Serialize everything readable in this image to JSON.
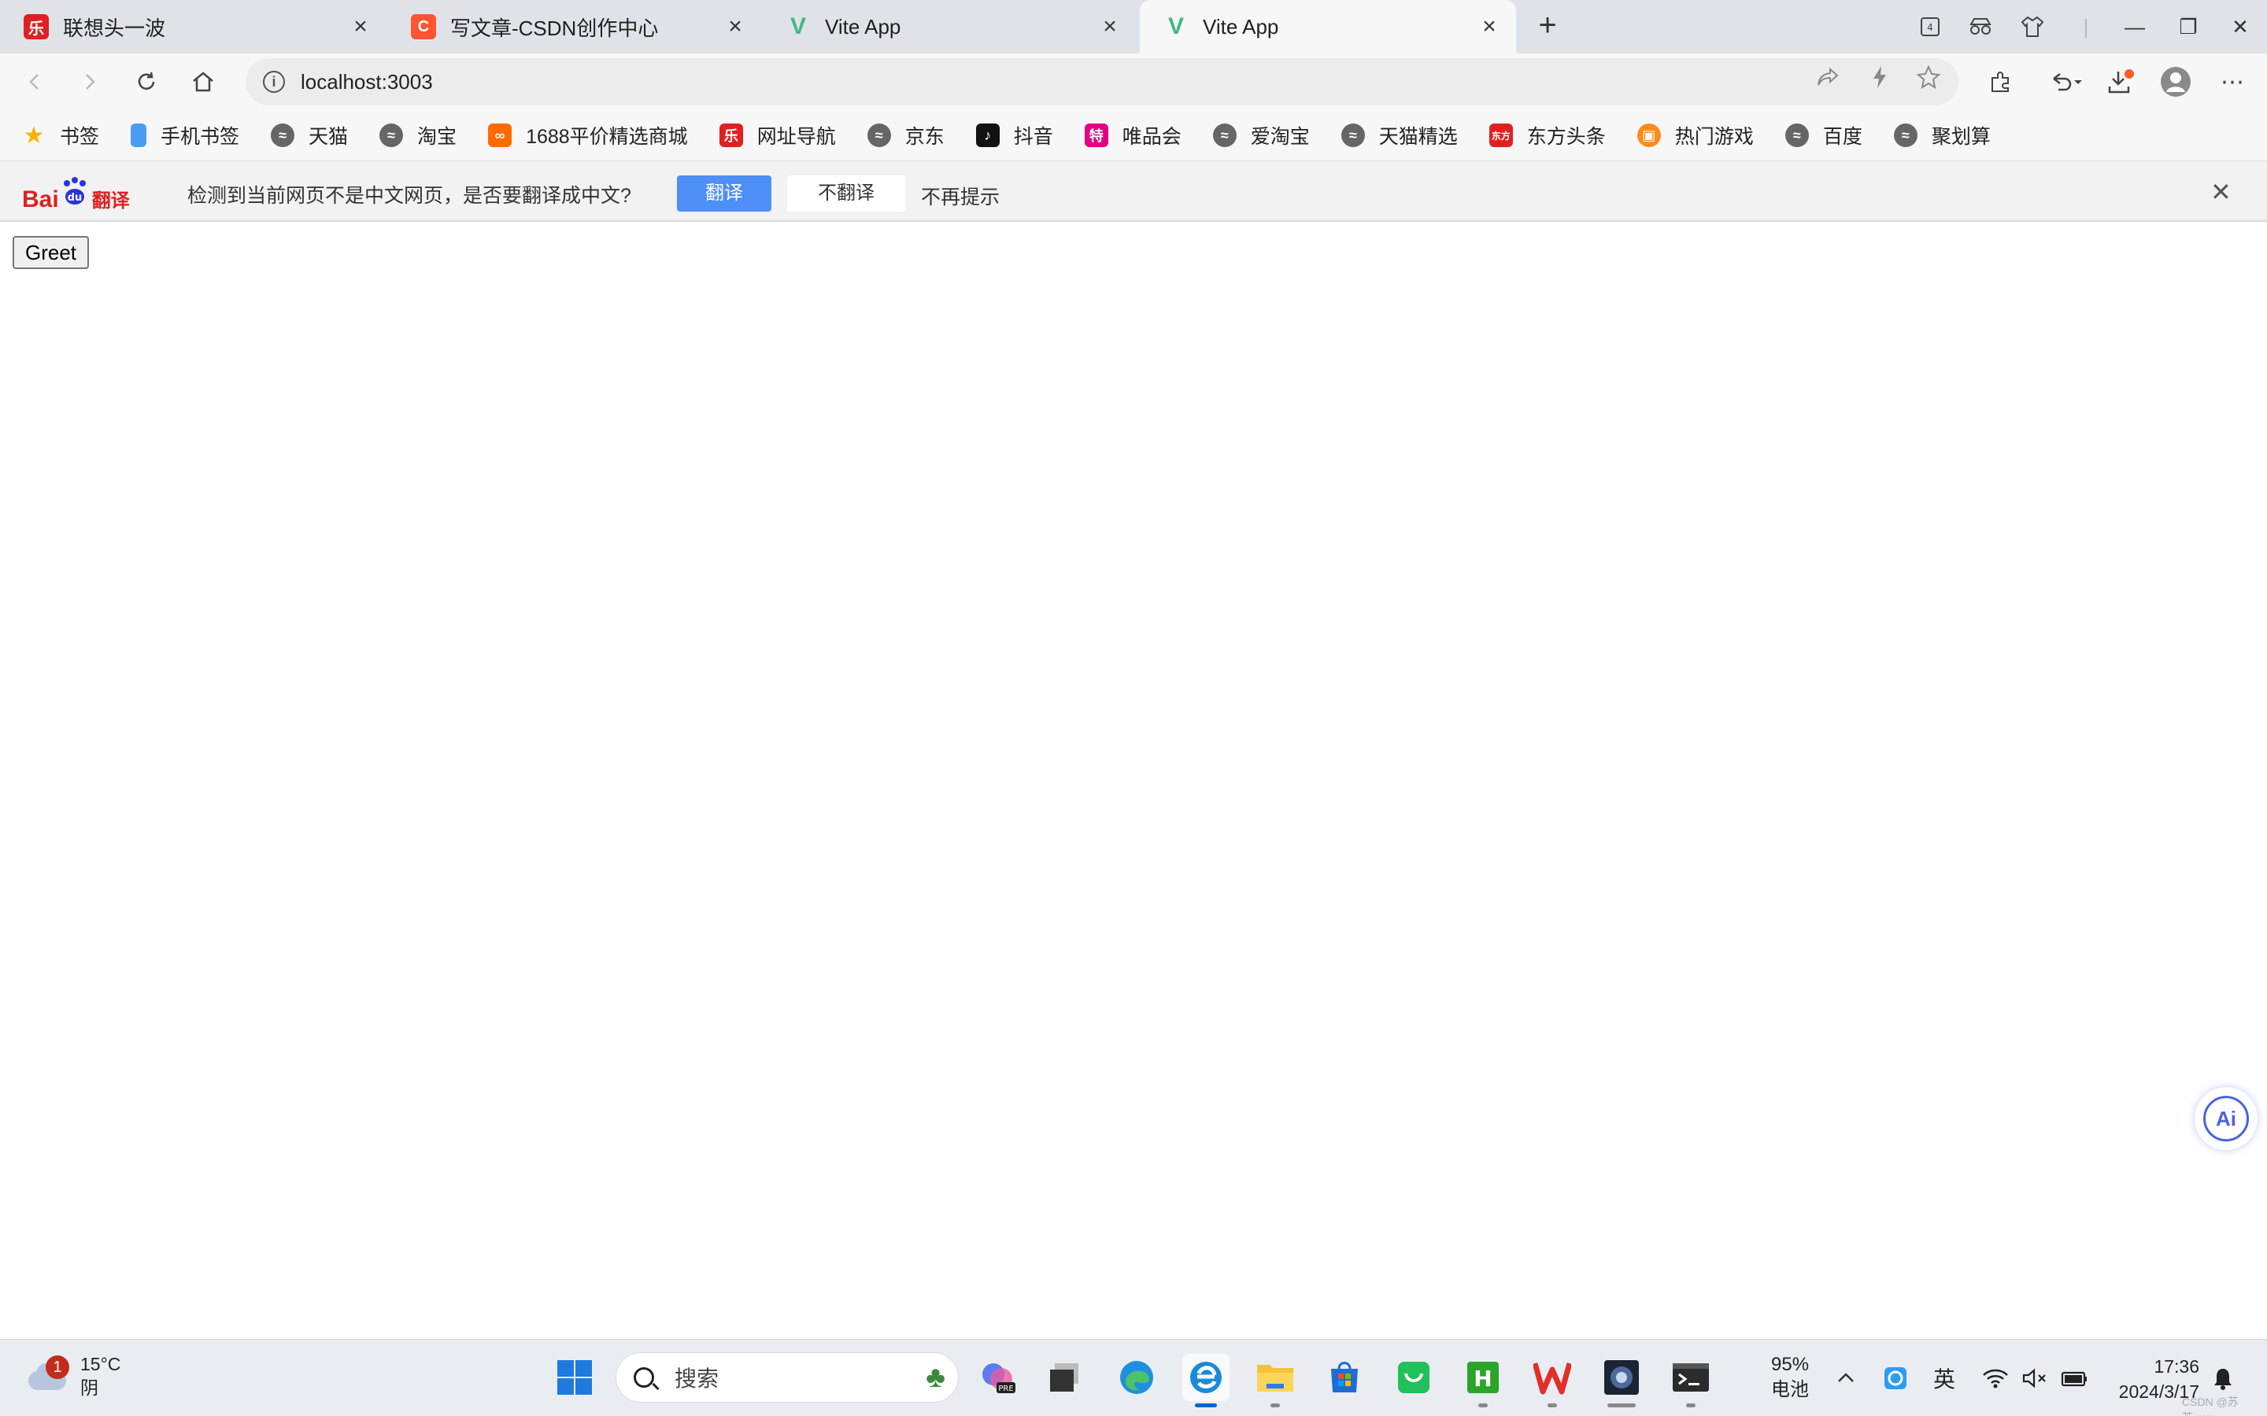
{
  "tabs": [
    {
      "title": "联想头一波",
      "favicon_color": "#e02020",
      "favicon_glyph": "乐"
    },
    {
      "title": "写文章-CSDN创作中心",
      "favicon_color": "#fc5531",
      "favicon_glyph": "C"
    },
    {
      "title": "Vite App",
      "favicon_color": "#42b883",
      "favicon_glyph": "V"
    },
    {
      "title": "Vite App",
      "favicon_color": "#42b883",
      "favicon_glyph": "V"
    }
  ],
  "window_controls": {
    "new_tab": "+",
    "minimize": "—",
    "restore": "❐",
    "close": "✕"
  },
  "address_bar": {
    "url": "localhost:3003",
    "info": "i"
  },
  "bookmarks": [
    {
      "label": "书签",
      "icon": "star-icon",
      "color": "#f5b400"
    },
    {
      "label": "手机书签",
      "icon": "phone-icon",
      "color": "#4b9cf5"
    },
    {
      "label": "天猫",
      "icon": "globe-icon",
      "color": "#666666"
    },
    {
      "label": "淘宝",
      "icon": "globe-icon",
      "color": "#666666"
    },
    {
      "label": "1688平价精选商城",
      "icon": "1688-icon",
      "color": "#ff6a00"
    },
    {
      "label": "网址导航",
      "icon": "nav-icon",
      "color": "#e02020"
    },
    {
      "label": "京东",
      "icon": "globe-icon",
      "color": "#666666"
    },
    {
      "label": "抖音",
      "icon": "douyin-icon",
      "color": "#111111"
    },
    {
      "label": "唯品会",
      "icon": "vip-icon",
      "color": "#e4007f"
    },
    {
      "label": "爱淘宝",
      "icon": "globe-icon",
      "color": "#666666"
    },
    {
      "label": "天猫精选",
      "icon": "globe-icon",
      "color": "#666666"
    },
    {
      "label": "东方头条",
      "icon": "dftt-icon",
      "color": "#e02020"
    },
    {
      "label": "热门游戏",
      "icon": "game-icon",
      "color": "#ff8c1a"
    },
    {
      "label": "百度",
      "icon": "globe-icon",
      "color": "#666666"
    },
    {
      "label": "聚划算",
      "icon": "globe-icon",
      "color": "#666666"
    }
  ],
  "translate": {
    "logo_bai": "Bai",
    "logo_du": "du",
    "logo_fanyi": "翻译",
    "message": "检测到当前网页不是中文网页，是否要翻译成中文?",
    "translate_label": "翻译",
    "no_translate_label": "不翻译",
    "no_remind_label": "不再提示",
    "close": "✕"
  },
  "page": {
    "greet_button": "Greet",
    "ai_label": "Ai"
  },
  "taskbar": {
    "weather": {
      "badge": "1",
      "temp": "15°C",
      "condition": "阴"
    },
    "search_placeholder": "搜索",
    "battery": {
      "percent": "95%",
      "label": "电池"
    },
    "ime": "英",
    "time": "17:36",
    "date": "2024/3/17"
  },
  "watermark": "CSDN @苏苏.ww"
}
